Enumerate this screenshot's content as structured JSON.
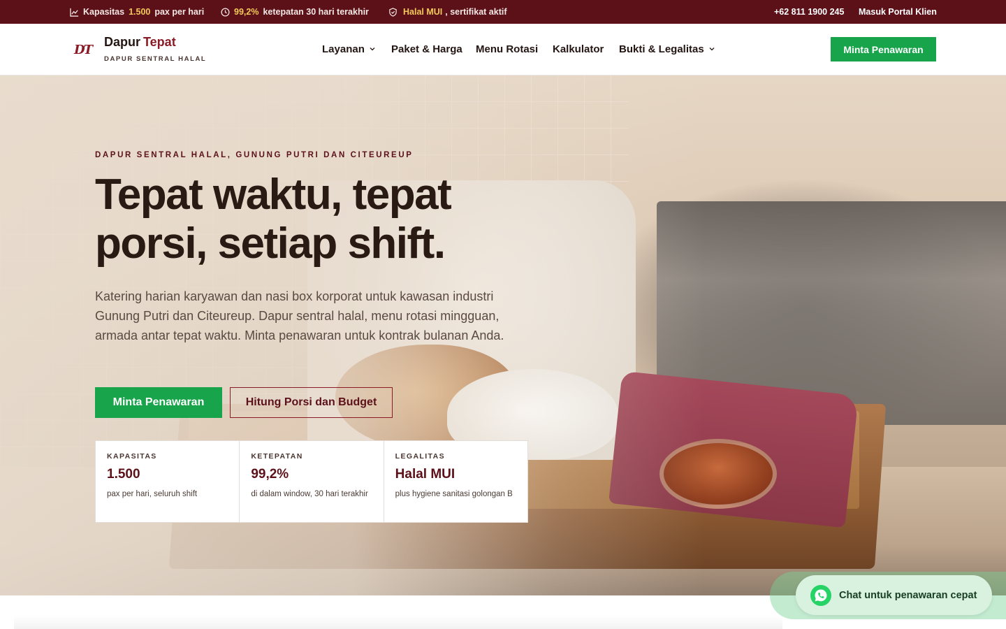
{
  "topbar": {
    "capacity_prefix": "Kapasitas",
    "capacity_value": "1.500",
    "capacity_suffix": "pax per hari",
    "accuracy_value": "99,2%",
    "accuracy_suffix": "ketepatan 30 hari terakhir",
    "halal_value": "Halal MUI",
    "halal_suffix": ", sertifikat aktif",
    "phone": "+62 811 1900 245",
    "portal": "Masuk Portal Klien",
    "icons": [
      "chart-icon",
      "clock-icon",
      "shield-icon"
    ]
  },
  "header": {
    "logo_mark": "DT",
    "brand_part1": "Dapur",
    "brand_part2": "Tepat",
    "brand_sub": "DAPUR SENTRAL HALAL",
    "nav": [
      {
        "label": "Layanan",
        "has_dropdown": true
      },
      {
        "label": "Paket & Harga",
        "has_dropdown": false
      },
      {
        "label": "Menu Rotasi",
        "has_dropdown": false
      },
      {
        "label": "Kalkulator",
        "has_dropdown": false
      },
      {
        "label": "Bukti & Legalitas",
        "has_dropdown": true
      }
    ],
    "cta": "Minta Penawaran"
  },
  "hero": {
    "eyebrow": "DAPUR SENTRAL HALAL, GUNUNG PUTRI DAN CITEUREUP",
    "title": "Tepat waktu, tepat porsi, setiap shift.",
    "description": "Katering harian karyawan dan nasi box korporat untuk kawasan industri Gunung Putri dan Citeureup. Dapur sentral halal, menu rotasi mingguan, armada antar tepat waktu. Minta penawaran untuk kontrak bulanan Anda.",
    "primary_button": "Minta Penawaran",
    "secondary_button": "Hitung Porsi dan Budget",
    "stats": [
      {
        "label": "KAPASITAS",
        "value": "1.500",
        "note": "pax per hari, seluruh shift"
      },
      {
        "label": "KETEPATAN",
        "value": "99,2%",
        "note": "di dalam window, 30 hari terakhir"
      },
      {
        "label": "LEGALITAS",
        "value": "Halal MUI",
        "note": "plus hygiene sanitasi golongan B"
      }
    ]
  },
  "chat": {
    "label": "Chat untuk penawaran cepat",
    "icon": "whatsapp-icon"
  },
  "colors": {
    "brand_maroon": "#5c1119",
    "accent_red": "#8a1b26",
    "cta_green": "#17a44a",
    "highlight_gold": "#f2c95a",
    "chat_bg": "#d8f2df"
  }
}
